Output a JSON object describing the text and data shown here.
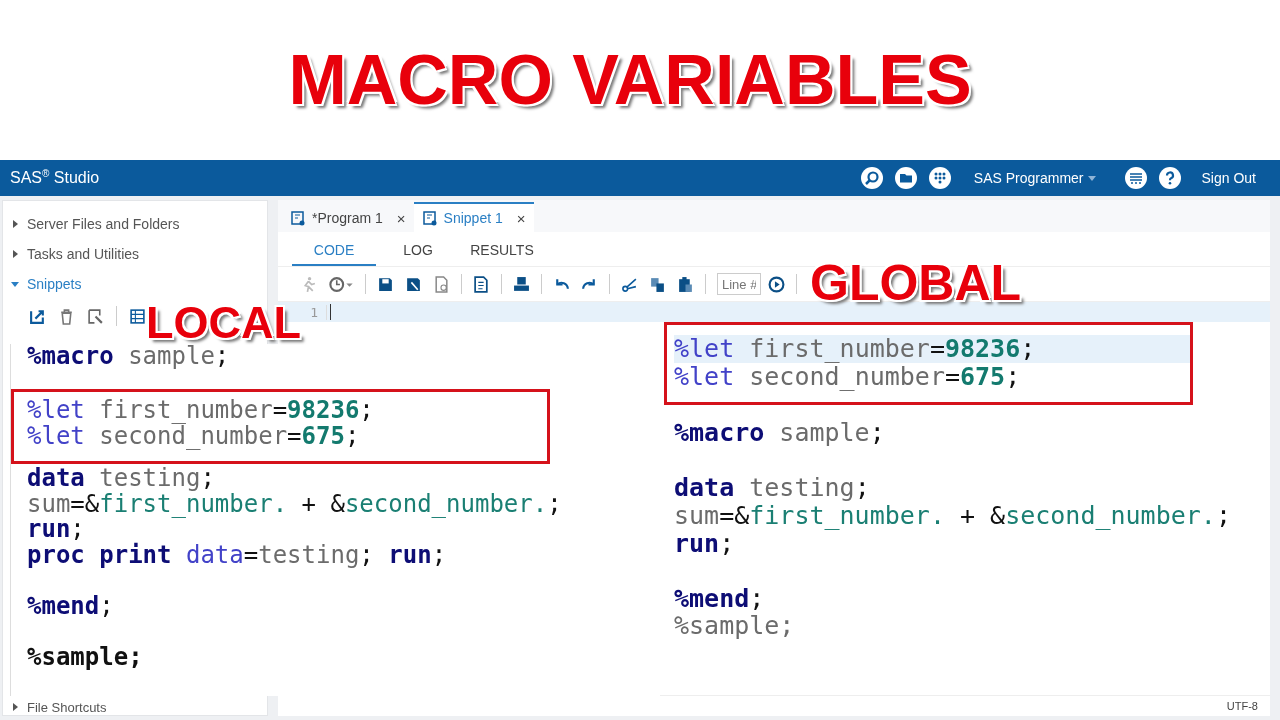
{
  "title": "MACRO VARIABLES",
  "app": {
    "brand": "SAS$^{®}$ Studio",
    "role": "SAS Programmer",
    "sign_out": "Sign Out",
    "sidebar": {
      "sections": [
        {
          "label": "Server Files and Folders",
          "expanded": false
        },
        {
          "label": "Tasks and Utilities",
          "expanded": false
        },
        {
          "label": "Snippets",
          "expanded": true
        }
      ],
      "footer": {
        "label": "File Shortcuts",
        "expanded": false
      }
    },
    "tabs": [
      {
        "label": "*Program 1",
        "close": "×",
        "selected": false
      },
      {
        "label": "Snippet 1",
        "close": "×",
        "selected": true
      }
    ],
    "subtabs": [
      {
        "label": "CODE",
        "selected": true
      },
      {
        "label": "LOG",
        "selected": false
      },
      {
        "label": "RESULTS",
        "selected": false
      }
    ],
    "line_field": {
      "placeholder": "Line #"
    },
    "line_numbers": [
      "1"
    ],
    "status": "UTF-8"
  },
  "panels": [
    {
      "label": "LOCAL",
      "blocks": [
        {
          "highlighted": false,
          "lines": [
            {
              "kind": "code",
              "current": false,
              "tokens": [
                {
                  "kind": "kw",
                  "t": "%macro"
                },
                {
                  "kind": "id",
                  "t": " sample"
                },
                {
                  "kind": "op",
                  "t": ";"
                }
              ]
            },
            {
              "kind": "blank"
            }
          ]
        },
        {
          "highlighted": true,
          "lines": [
            {
              "kind": "code",
              "current": false,
              "tokens": [
                {
                  "kind": "mv",
                  "t": "%let"
                },
                {
                  "kind": "id",
                  "t": " first_number"
                },
                {
                  "kind": "op",
                  "t": "="
                },
                {
                  "kind": "num",
                  "t": "98236"
                },
                {
                  "kind": "op",
                  "t": ";"
                }
              ]
            },
            {
              "kind": "code",
              "current": false,
              "tokens": [
                {
                  "kind": "mv",
                  "t": "%let"
                },
                {
                  "kind": "id",
                  "t": " second_number"
                },
                {
                  "kind": "op",
                  "t": "="
                },
                {
                  "kind": "num",
                  "t": "675"
                },
                {
                  "kind": "op",
                  "t": ";"
                }
              ]
            }
          ]
        },
        {
          "highlighted": false,
          "lines": [
            {
              "kind": "code",
              "current": false,
              "tokens": [
                {
                  "kind": "kw",
                  "t": "data"
                },
                {
                  "kind": "id",
                  "t": " testing"
                },
                {
                  "kind": "op",
                  "t": ";"
                }
              ]
            },
            {
              "kind": "code",
              "current": false,
              "tokens": [
                {
                  "kind": "id",
                  "t": "sum"
                },
                {
                  "kind": "op",
                  "t": "=&"
                },
                {
                  "kind": "ref",
                  "t": "first_number."
                },
                {
                  "kind": "op",
                  "t": " + &"
                },
                {
                  "kind": "ref",
                  "t": "second_number."
                },
                {
                  "kind": "op",
                  "t": ";"
                }
              ]
            },
            {
              "kind": "code",
              "current": false,
              "tokens": [
                {
                  "kind": "kw",
                  "t": "run"
                },
                {
                  "kind": "op",
                  "t": ";"
                }
              ]
            },
            {
              "kind": "code",
              "current": false,
              "tokens": [
                {
                  "kind": "kw",
                  "t": "proc print"
                },
                {
                  "kind": "mv",
                  "t": " data"
                },
                {
                  "kind": "op",
                  "t": "="
                },
                {
                  "kind": "id",
                  "t": "testing"
                },
                {
                  "kind": "op",
                  "t": "; "
                },
                {
                  "kind": "kw",
                  "t": "run"
                },
                {
                  "kind": "op",
                  "t": ";"
                }
              ]
            },
            {
              "kind": "blank"
            },
            {
              "kind": "code",
              "current": false,
              "tokens": [
                {
                  "kind": "kw",
                  "t": "%mend"
                },
                {
                  "kind": "op",
                  "t": ";"
                }
              ]
            },
            {
              "kind": "blank"
            },
            {
              "kind": "code",
              "current": false,
              "tokens": [
                {
                  "kind": "call",
                  "t": "%sample;"
                }
              ]
            }
          ]
        }
      ]
    },
    {
      "label": "GLOBAL",
      "blocks": [
        {
          "highlighted": true,
          "lines": [
            {
              "kind": "code",
              "current": true,
              "tokens": [
                {
                  "kind": "mv",
                  "t": "%let"
                },
                {
                  "kind": "id",
                  "t": " first_number"
                },
                {
                  "kind": "op",
                  "t": "="
                },
                {
                  "kind": "num",
                  "t": "98236"
                },
                {
                  "kind": "op",
                  "t": ";"
                }
              ]
            },
            {
              "kind": "code",
              "current": false,
              "tokens": [
                {
                  "kind": "mv",
                  "t": "%let"
                },
                {
                  "kind": "id",
                  "t": " second_number"
                },
                {
                  "kind": "op",
                  "t": "="
                },
                {
                  "kind": "num",
                  "t": "675"
                },
                {
                  "kind": "op",
                  "t": ";"
                }
              ]
            }
          ]
        },
        {
          "highlighted": false,
          "lines": [
            {
              "kind": "code",
              "current": false,
              "tokens": [
                {
                  "kind": "kw",
                  "t": "%macro"
                },
                {
                  "kind": "id",
                  "t": " sample"
                },
                {
                  "kind": "op",
                  "t": ";"
                }
              ]
            },
            {
              "kind": "blank"
            },
            {
              "kind": "code",
              "current": false,
              "tokens": [
                {
                  "kind": "kw",
                  "t": "data"
                },
                {
                  "kind": "id",
                  "t": " testing"
                },
                {
                  "kind": "op",
                  "t": ";"
                }
              ]
            },
            {
              "kind": "code",
              "current": false,
              "tokens": [
                {
                  "kind": "id",
                  "t": "sum"
                },
                {
                  "kind": "op",
                  "t": "=&"
                },
                {
                  "kind": "ref",
                  "t": "first_number."
                },
                {
                  "kind": "op",
                  "t": " + &"
                },
                {
                  "kind": "ref",
                  "t": "second_number."
                },
                {
                  "kind": "op",
                  "t": ";"
                }
              ]
            },
            {
              "kind": "code",
              "current": false,
              "tokens": [
                {
                  "kind": "kw",
                  "t": "run"
                },
                {
                  "kind": "op",
                  "t": ";"
                }
              ]
            },
            {
              "kind": "blank"
            },
            {
              "kind": "code",
              "current": false,
              "tokens": [
                {
                  "kind": "kw",
                  "t": "%mend"
                },
                {
                  "kind": "op",
                  "t": ";"
                }
              ]
            },
            {
              "kind": "code",
              "current": false,
              "tokens": [
                {
                  "kind": "id",
                  "t": "%sample;"
                }
              ]
            }
          ]
        }
      ]
    }
  ]
}
